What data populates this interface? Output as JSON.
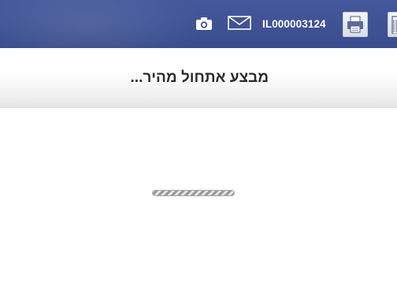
{
  "header": {
    "user_id": "IL000003124",
    "icons": [
      "camera-icon",
      "mail-icon",
      "printer-icon",
      "calculator-icon"
    ],
    "background_color": "#3f5294"
  },
  "loading": {
    "message": "מבצע אתחול מהיר...",
    "progress_fraction": 1.0
  }
}
